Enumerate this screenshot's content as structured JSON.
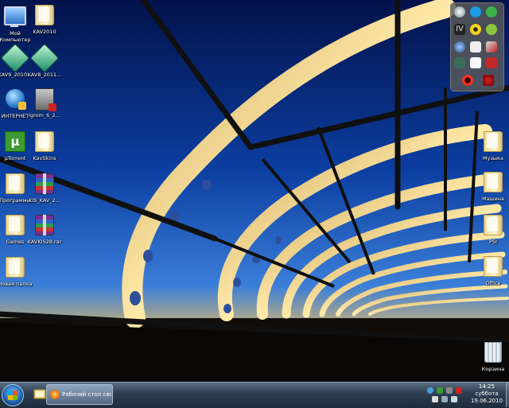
{
  "desktop": {
    "icons_left": [
      {
        "label": "Мой Компьютер",
        "kind": "computer"
      },
      {
        "label": "KAV2010",
        "kind": "folder"
      },
      {
        "label": "KAV9_2010...",
        "kind": "kav"
      },
      {
        "label": "KAV8_2011...",
        "kind": "kav"
      },
      {
        "label": "ИНТЕРНЕТ",
        "kind": "internet"
      },
      {
        "label": "igrom_6_2...",
        "kind": "pdf"
      },
      {
        "label": "µTorrent",
        "kind": "torrent"
      },
      {
        "label": "KavSkins",
        "kind": "folder"
      },
      {
        "label": "Программы",
        "kind": "folder"
      },
      {
        "label": "KIS_KAV_2...",
        "kind": "archive"
      },
      {
        "label": "Games",
        "kind": "folder"
      },
      {
        "label": "KAVKIS28.rar",
        "kind": "archive"
      },
      {
        "label": "Новая папка",
        "kind": "folder"
      }
    ],
    "icons_right": [
      {
        "label": "Музыка",
        "kind": "folder"
      },
      {
        "label": "Машина",
        "kind": "folder"
      },
      {
        "label": "PSI",
        "kind": "folder"
      },
      {
        "label": "Office",
        "kind": "folder"
      },
      {
        "label": "Корзина",
        "kind": "recycle-bin"
      }
    ]
  },
  "gadget_panel": {
    "icons": [
      "search-icon",
      "skype-icon",
      "gear-icon",
      "roman-four-icon",
      "radiation-icon",
      "bug-icon",
      "globe-icon",
      "pen-icon",
      "rocket-icon",
      "document-icon",
      "red-icon",
      "opera-icon",
      "spider-icon"
    ]
  },
  "taskbar": {
    "task_button_label": "Рабочий стол свой ...",
    "clock_time": "14:25",
    "clock_day": "суббота",
    "clock_date": "19.06.2010"
  }
}
